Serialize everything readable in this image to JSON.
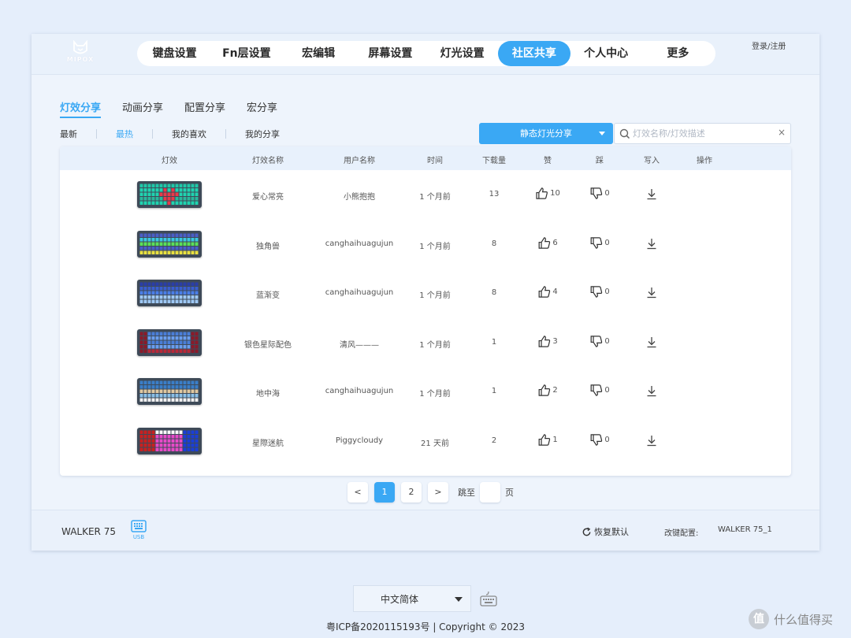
{
  "header": {
    "logo_text": "MIPOX",
    "nav": [
      {
        "label": "键盘设置"
      },
      {
        "label": "Fn层设置"
      },
      {
        "label": "宏编辑"
      },
      {
        "label": "屏幕设置"
      },
      {
        "label": "灯光设置"
      },
      {
        "label": "社区共享",
        "active": true
      },
      {
        "label": "个人中心"
      },
      {
        "label": "更多"
      }
    ],
    "login": "登录/注册"
  },
  "subtabs": [
    "灯效分享",
    "动画分享",
    "配置分享",
    "宏分享"
  ],
  "filters": [
    "最新",
    "最热",
    "我的喜欢",
    "我的分享"
  ],
  "dropdown": {
    "label": "静态灯光分享"
  },
  "search": {
    "placeholder": "灯效名称/灯效描述",
    "clear": "×"
  },
  "table": {
    "headers": [
      "灯效",
      "灯效名称",
      "用户名称",
      "时间",
      "下载量",
      "赞",
      "踩",
      "写入",
      "操作"
    ],
    "rows": [
      {
        "name": "爱心常亮",
        "user": "小熊抱抱",
        "time": "1 个月前",
        "downloads": "13",
        "likes": "10",
        "dislikes": "0",
        "thumb": "heart"
      },
      {
        "name": "独角兽",
        "user": "canghaihuagujun",
        "time": "1 个月前",
        "downloads": "8",
        "likes": "6",
        "dislikes": "0",
        "thumb": "unicorn"
      },
      {
        "name": "蓝渐变",
        "user": "canghaihuagujun",
        "time": "1 个月前",
        "downloads": "8",
        "likes": "4",
        "dislikes": "0",
        "thumb": "blue"
      },
      {
        "name": "银色星际配色",
        "user": "清风———",
        "time": "1 个月前",
        "downloads": "1",
        "likes": "3",
        "dislikes": "0",
        "thumb": "silver"
      },
      {
        "name": "地中海",
        "user": "canghaihuagujun",
        "time": "1 个月前",
        "downloads": "1",
        "likes": "2",
        "dislikes": "0",
        "thumb": "med"
      },
      {
        "name": "星際迷航",
        "user": "Piggycloudy",
        "time": "21 天前",
        "downloads": "2",
        "likes": "1",
        "dislikes": "0",
        "thumb": "star"
      }
    ]
  },
  "pager": {
    "prev": "<",
    "pages": [
      "1",
      "2"
    ],
    "next": ">",
    "jump_label": "跳至",
    "page_suffix": "页"
  },
  "footer": {
    "model": "WALKER 75",
    "usb": "USB",
    "restore": "恢复默认",
    "keymap_label": "改键配置:",
    "keymap_value": "WALKER 75_1"
  },
  "lang": "中文简体",
  "copyright": "粤ICP备2020115193号 | Copyright © 2023",
  "watermark": "什么值得买",
  "colors": {
    "accent": "#3aa8f4",
    "background": "#e5eefb"
  }
}
